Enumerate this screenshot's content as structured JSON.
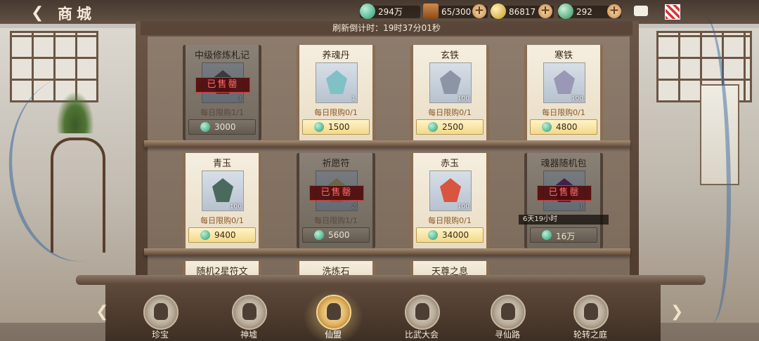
{
  "header": {
    "back_icon": "back-arrow-icon",
    "title": "商城"
  },
  "resources": [
    {
      "icon": "jade-icon",
      "value": "294万",
      "has_plus": false
    },
    {
      "icon": "chest-icon",
      "value": "65/300",
      "has_plus": true
    },
    {
      "icon": "gold-dragon-icon",
      "value": "86817",
      "has_plus": true
    },
    {
      "icon": "green-dragon-icon",
      "value": "292",
      "has_plus": true
    }
  ],
  "refresh": {
    "text": "刷新倒计时：19时37分01秒"
  },
  "sold_label": "已售罄",
  "items": [
    {
      "name": "中级修炼札记",
      "qty": "3",
      "limit": "每日限购1/1",
      "price": "3000",
      "sold_out": true,
      "color": "#6b6a70"
    },
    {
      "name": "养魂丹",
      "qty": "1",
      "limit": "每日限购0/1",
      "price": "1500",
      "sold_out": false,
      "color": "#7fc1c6"
    },
    {
      "name": "玄铁",
      "qty": "100",
      "limit": "每日限购0/1",
      "price": "2500",
      "sold_out": false,
      "color": "#8c95a6"
    },
    {
      "name": "寒铁",
      "qty": "100",
      "limit": "每日限购0/1",
      "price": "4800",
      "sold_out": false,
      "color": "#9a98b4"
    },
    {
      "name": "青玉",
      "qty": "100",
      "limit": "每日限购0/1",
      "price": "9400",
      "sold_out": false,
      "color": "#4a6a5e"
    },
    {
      "name": "祈愿符",
      "qty": "2",
      "limit": "每日限购1/1",
      "price": "5600",
      "sold_out": true,
      "color": "#c9b67a"
    },
    {
      "name": "赤玉",
      "qty": "100",
      "limit": "每日限购0/1",
      "price": "34000",
      "sold_out": false,
      "color": "#d8553f"
    },
    {
      "name": "魂器随机包",
      "qty": "1",
      "limit": "",
      "price": "16万",
      "sold_out": true,
      "color": "#7a3a8a",
      "timer": "6天19小时"
    },
    {
      "name": "随机2星符文",
      "partial": true
    },
    {
      "name": "洗炼石",
      "partial": true
    },
    {
      "name": "天尊之息",
      "partial": true
    }
  ],
  "tabs": [
    {
      "label": "珍宝",
      "icon": "treasure-icon",
      "active": false
    },
    {
      "label": "神墟",
      "icon": "ruins-icon",
      "active": false
    },
    {
      "label": "仙盟",
      "icon": "alliance-icon",
      "active": true
    },
    {
      "label": "比武大会",
      "icon": "tournament-icon",
      "active": false
    },
    {
      "label": "寻仙路",
      "icon": "scroll-icon",
      "active": false
    },
    {
      "label": "轮转之庭",
      "icon": "court-icon",
      "active": false
    }
  ]
}
